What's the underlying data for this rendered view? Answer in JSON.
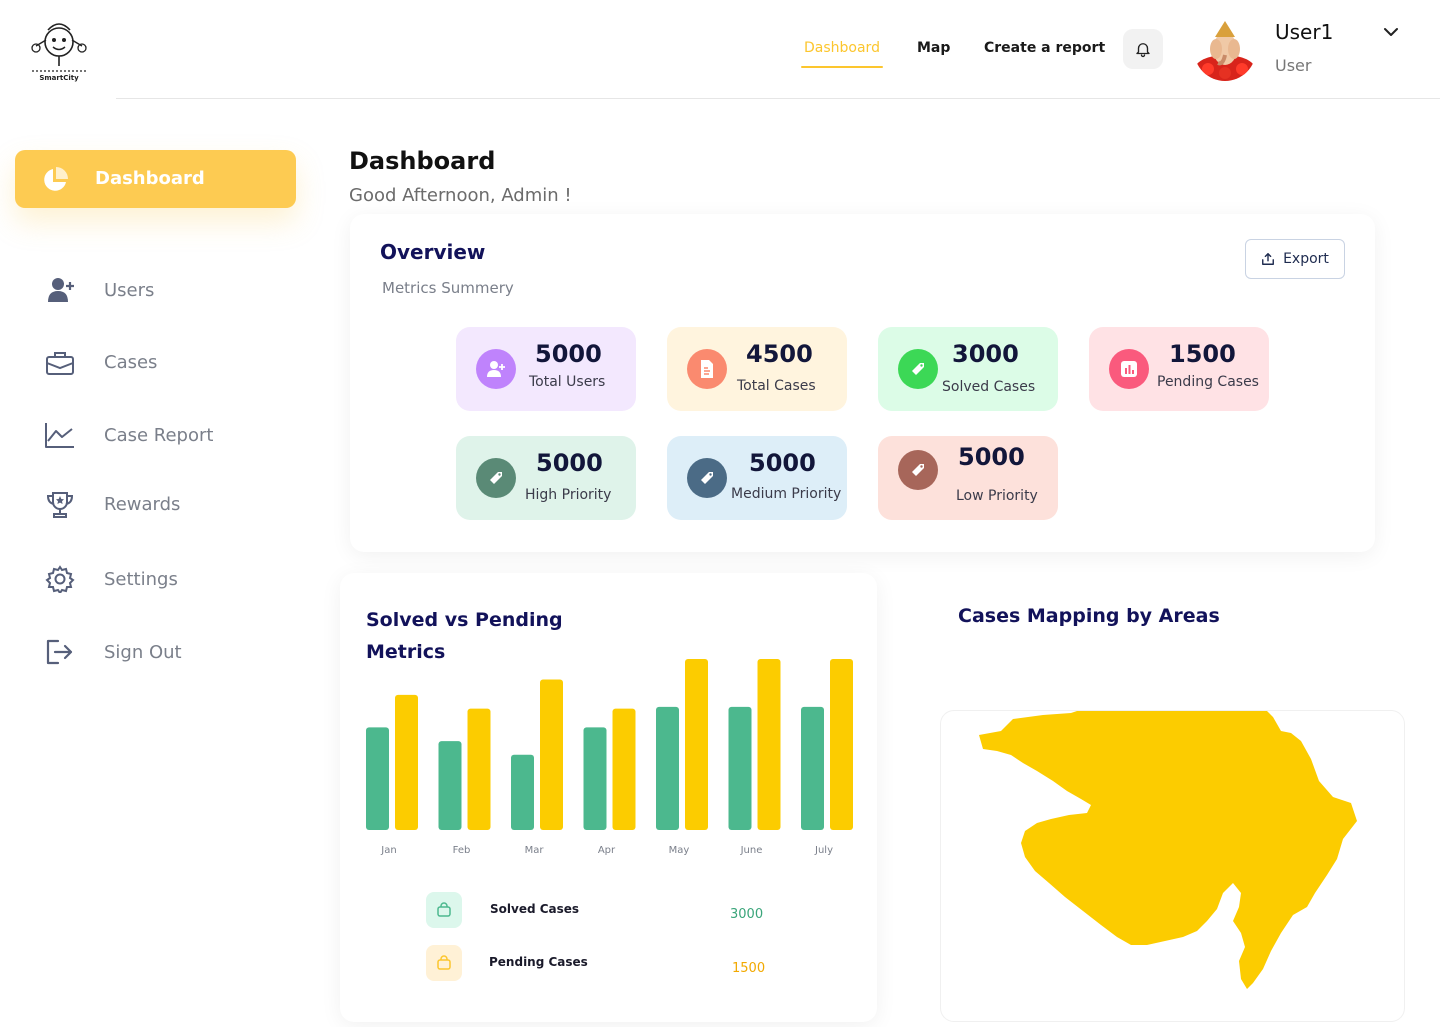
{
  "brand": {
    "name": "SmartCity"
  },
  "header": {
    "nav": [
      {
        "label": "Dashboard",
        "active": true
      },
      {
        "label": "Map",
        "active": false
      },
      {
        "label": "Create a report",
        "active": false
      }
    ],
    "notification_icon": "bell-icon",
    "user": {
      "name": "User1",
      "role": "User"
    },
    "accent": "#fcc62e"
  },
  "sidebar": {
    "items": [
      {
        "label": "Dashboard",
        "icon": "pie-chart-icon",
        "active": true
      },
      {
        "label": "Users",
        "icon": "user-add-icon"
      },
      {
        "label": "Cases",
        "icon": "briefcase-icon"
      },
      {
        "label": "Case Report",
        "icon": "line-chart-icon"
      },
      {
        "label": "Rewards",
        "icon": "trophy-icon"
      },
      {
        "label": "Settings",
        "icon": "gear-icon"
      },
      {
        "label": "Sign Out",
        "icon": "sign-out-icon"
      }
    ]
  },
  "page": {
    "title": "Dashboard",
    "greeting": "Good Afternoon, Admin !"
  },
  "overview": {
    "title": "Overview",
    "subtitle": "Metrics Summery",
    "export_label": "Export",
    "metrics": [
      {
        "value": "5000",
        "label": "Total Users",
        "icon": "user-add-icon",
        "bg": "#f3e8fe",
        "circle": "#bf83fc"
      },
      {
        "value": "4500",
        "label": "Total Cases",
        "icon": "document-icon",
        "bg": "#fff4de",
        "circle": "#fa8a6f"
      },
      {
        "value": "3000",
        "label": "Solved Cases",
        "icon": "tag-icon",
        "bg": "#dcfce7",
        "circle": "#3cd856"
      },
      {
        "value": "1500",
        "label": "Pending Cases",
        "icon": "bar-chart-icon",
        "bg": "#ffe2e5",
        "circle": "#fa5a7d"
      },
      {
        "value": "5000",
        "label": "High Priority",
        "icon": "tag-icon",
        "bg": "#dff3ea",
        "circle": "#5a8a76"
      },
      {
        "value": "5000",
        "label": "Medium Priority",
        "icon": "tag-icon",
        "bg": "#ddeef8",
        "circle": "#4b6b86"
      },
      {
        "value": "5000",
        "label": "Low Priority",
        "icon": "tag-icon",
        "bg": "#fde1db",
        "circle": "#a7665a"
      }
    ]
  },
  "chart_card": {
    "title": "Solved vs Pending Metrics",
    "legend": [
      {
        "label": "Solved Cases",
        "value": "3000",
        "color": "#4cb88e",
        "bg": "#dcf7ec",
        "icon": "bag-icon"
      },
      {
        "label": "Pending Cases",
        "value": "1500",
        "color": "#fcc62e",
        "bg": "#fff1d6",
        "icon": "bag-icon"
      }
    ]
  },
  "chart_data": {
    "type": "bar",
    "categories": [
      "Jan",
      "Feb",
      "Mar",
      "Apr",
      "May",
      "June",
      "July"
    ],
    "series": [
      {
        "name": "Solved Cases",
        "color": "#4cb88e",
        "values": [
          60,
          52,
          44,
          60,
          72,
          72,
          72
        ]
      },
      {
        "name": "Pending Cases",
        "color": "#fccc00",
        "values": [
          79,
          71,
          88,
          71,
          100,
          100,
          100
        ]
      }
    ],
    "ylim": [
      0,
      100
    ],
    "grid": false,
    "title": "Solved vs Pending Metrics"
  },
  "map": {
    "title": "Cases Mapping by Areas",
    "fill": "#fccc00"
  }
}
